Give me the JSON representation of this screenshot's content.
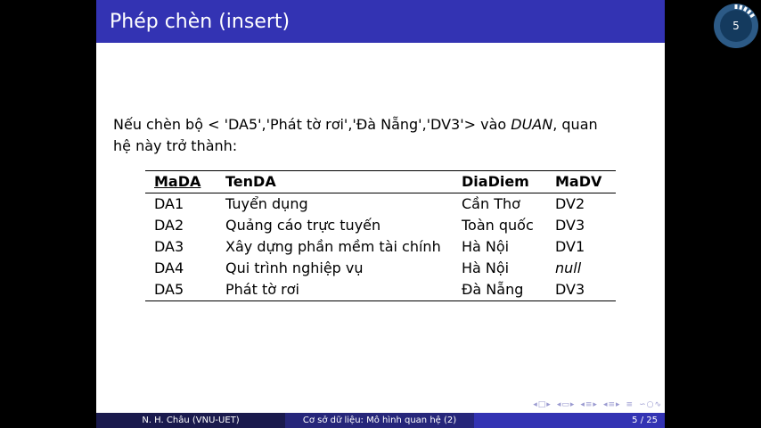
{
  "slide": {
    "title": "Phép chèn (insert)",
    "text_line1_a": "Nếu chèn bộ < 'DA5','Phát tờ rơi','Đà Nẵng','DV3'> vào ",
    "text_line1_rel": "DUAN",
    "text_line1_b": ", quan",
    "text_line2": "hệ này trở thành:"
  },
  "table": {
    "headers": [
      "MaDA",
      "TenDA",
      "DiaDiem",
      "MaDV"
    ],
    "rows": [
      [
        "DA1",
        "Tuyển dụng",
        "Cần Thơ",
        "DV2"
      ],
      [
        "DA2",
        "Quảng cáo trực tuyến",
        "Toàn quốc",
        "DV3"
      ],
      [
        "DA3",
        "Xây dựng phần mềm tài chính",
        "Hà Nội",
        "DV1"
      ],
      [
        "DA4",
        "Qui trình nghiệp vụ",
        "Hà Nội",
        "null"
      ],
      [
        "DA5",
        "Phát tờ rơi",
        "Đà Nẵng",
        "DV3"
      ]
    ]
  },
  "footer": {
    "author": "N. H. Châu  (VNU-UET)",
    "course": "Cơ sở dữ liệu: Mô hình quan hệ (2)",
    "page": "5 / 25"
  },
  "badge": {
    "number": "5",
    "progress": 0.2
  },
  "colors": {
    "title_bar": "#3333b3",
    "footer_left": "#1a1a4d",
    "footer_mid": "#26267a",
    "footer_right": "#3333b3"
  }
}
